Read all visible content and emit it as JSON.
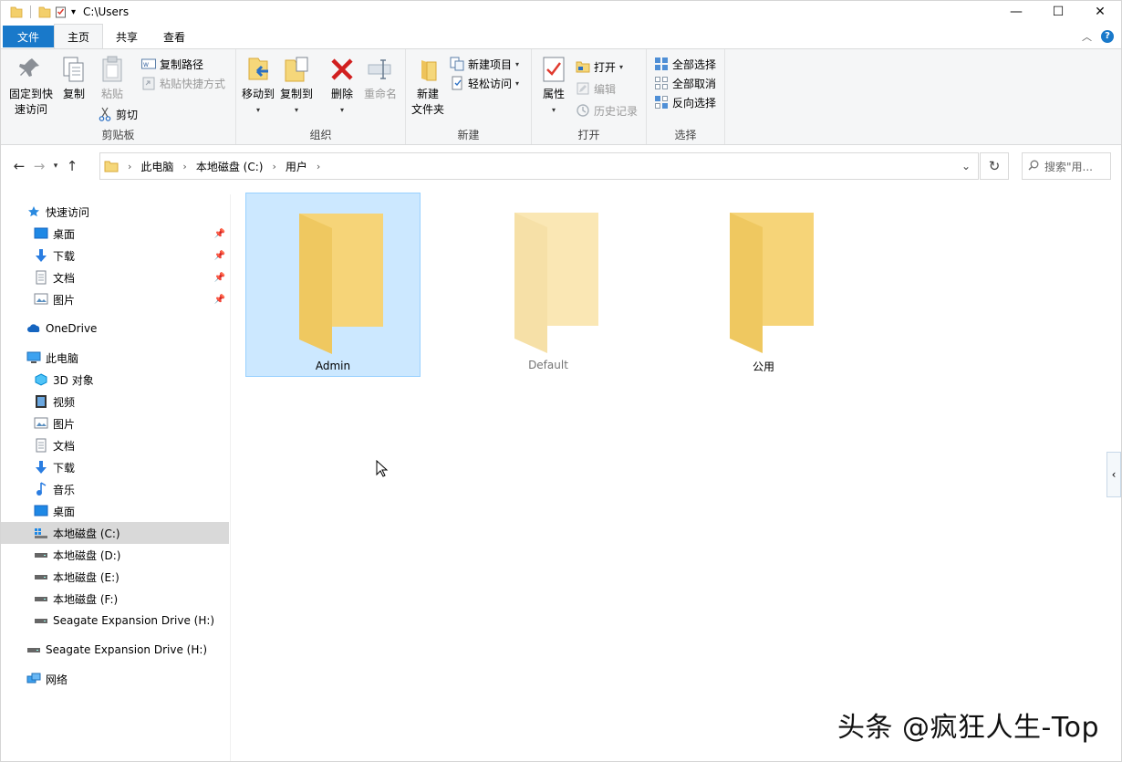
{
  "window": {
    "title": "C:\\Users"
  },
  "window_buttons": {
    "minimize": "—",
    "maximize": "☐",
    "close": "✕"
  },
  "tabs": [
    {
      "label": "文件"
    },
    {
      "label": "主页"
    },
    {
      "label": "共享"
    },
    {
      "label": "查看"
    }
  ],
  "ribbon": {
    "clipboard": {
      "group_label": "剪贴板",
      "pin": "固定到快\n速访问",
      "copy": "复制",
      "paste": "粘贴",
      "copy_path": "复制路径",
      "paste_shortcut": "粘贴快捷方式",
      "cut": "剪切"
    },
    "organize": {
      "group_label": "组织",
      "move_to": "移动到",
      "copy_to": "复制到",
      "delete": "删除",
      "rename": "重命名"
    },
    "new": {
      "group_label": "新建",
      "new_folder": "新建\n文件夹",
      "new_item": "新建项目",
      "easy_access": "轻松访问"
    },
    "open": {
      "group_label": "打开",
      "properties": "属性",
      "open": "打开",
      "edit": "编辑",
      "history": "历史记录"
    },
    "select": {
      "group_label": "选择",
      "select_all": "全部选择",
      "select_none": "全部取消",
      "invert": "反向选择"
    }
  },
  "address": {
    "crumbs": [
      "此电脑",
      "本地磁盘 (C:)",
      "用户"
    ],
    "search_placeholder": "搜索\"用..."
  },
  "nav": {
    "quick_access": "快速访问",
    "qa_items": [
      "桌面",
      "下载",
      "文档",
      "图片"
    ],
    "onedrive": "OneDrive",
    "this_pc": "此电脑",
    "pc_items": [
      "3D 对象",
      "视频",
      "图片",
      "文档",
      "下载",
      "音乐",
      "桌面",
      "本地磁盘 (C:)",
      "本地磁盘 (D:)",
      "本地磁盘 (E:)",
      "本地磁盘 (F:)",
      "Seagate Expansion Drive (H:)"
    ],
    "seagate": "Seagate Expansion Drive (H:)",
    "network": "网络"
  },
  "folders": [
    {
      "name": "Admin",
      "selected": true
    },
    {
      "name": "Default",
      "hidden": true
    },
    {
      "name": "公用"
    }
  ],
  "watermark": "头条 @疯狂人生-Top",
  "colors": {
    "accent": "#1979ca",
    "selection": "#cce8ff",
    "folder": "#f5d77a"
  }
}
